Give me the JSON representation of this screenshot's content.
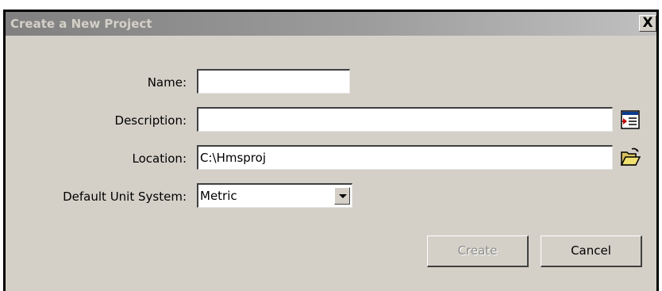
{
  "dialog": {
    "title": "Create a New Project",
    "close_label": "X"
  },
  "form": {
    "name": {
      "label": "Name:",
      "value": ""
    },
    "description": {
      "label": "Description:",
      "value": ""
    },
    "location": {
      "label": "Location:",
      "value": "C:\\Hmsproj"
    },
    "unit_system": {
      "label": "Default Unit System:",
      "value": "Metric"
    }
  },
  "buttons": {
    "create_label": "Create",
    "cancel_label": "Cancel"
  },
  "icons": {
    "description_button": "edit-description-icon",
    "location_button": "open-folder-icon"
  }
}
